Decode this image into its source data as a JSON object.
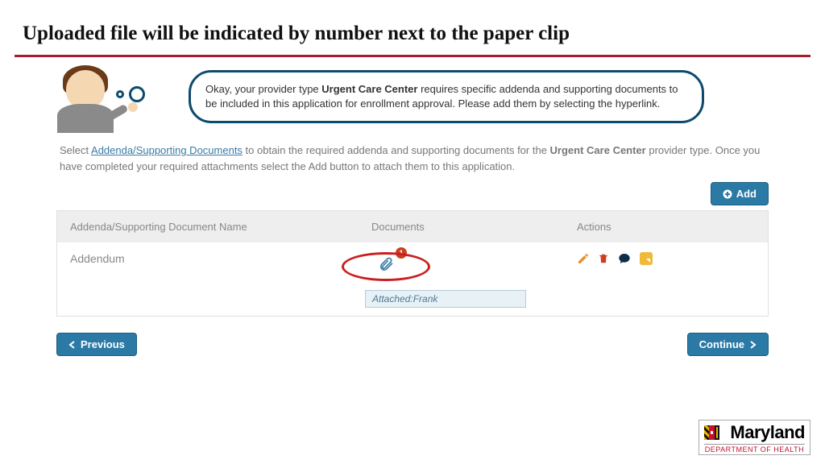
{
  "title": "Uploaded file will be indicated by number next to the paper clip",
  "speech": {
    "prefix": "Okay, your provider type ",
    "bold1": "Urgent Care Center",
    "mid": " requires specific addenda and supporting documents to be included in this application for enrollment approval. Please add them by selecting the hyperlink."
  },
  "instruction": {
    "prefix": "Select ",
    "link": "Addenda/Supporting Documents",
    "mid": " to obtain the required addenda and supporting documents for the ",
    "bold": "Urgent Care Center",
    "suffix": " provider type. Once you have completed your required attachments select the Add button to attach them to this application."
  },
  "buttons": {
    "add": "Add",
    "previous": "Previous",
    "continue": "Continue"
  },
  "table": {
    "headers": {
      "name": "Addenda/Supporting Document Name",
      "docs": "Documents",
      "actions": "Actions"
    },
    "rows": [
      {
        "name": "Addendum",
        "count": "1",
        "attached": "Attached:Frank"
      }
    ]
  },
  "logo": {
    "text": "Maryland",
    "sub": "DEPARTMENT OF HEALTH"
  }
}
